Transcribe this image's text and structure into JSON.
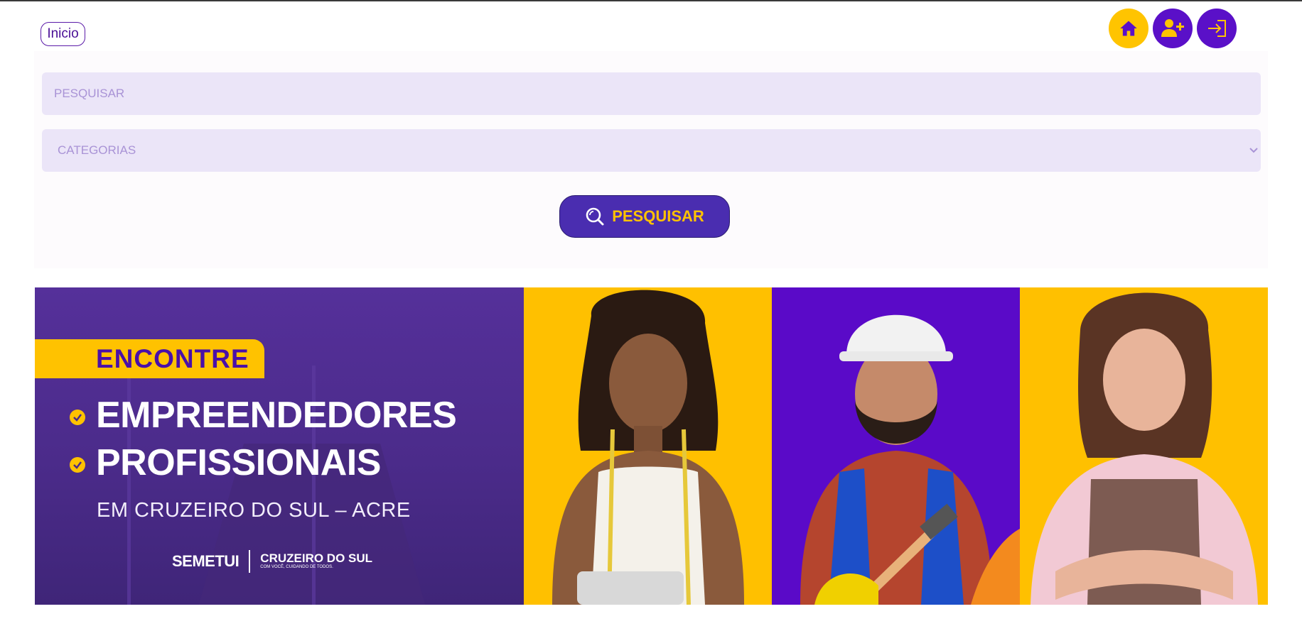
{
  "nav": {
    "inicio_label": "Inicio"
  },
  "header_icons": [
    {
      "icon": "home-icon",
      "color": "#ffc400"
    },
    {
      "icon": "user-plus-icon",
      "color": "#5a10c8"
    },
    {
      "icon": "login-icon",
      "color": "#5a10c8"
    }
  ],
  "search": {
    "placeholder": "PESQUISAR",
    "categories_placeholder": "CATEGORIAS",
    "button_label": "PESQUISAR"
  },
  "banner": {
    "tag": "ENCONTRE",
    "items": [
      "EMPREENDEDORES",
      "PROFISSIONAIS"
    ],
    "subtitle": "EM CRUZEIRO DO SUL – ACRE",
    "logo_semetui": "SEMETUI",
    "logo_cruzeiro": "CRUZEIRO DO SUL",
    "logo_cruzeiro_sub": "COM VOCÊ, CUIDANDO DE TODOS."
  },
  "colors": {
    "brand_purple": "#4a2db0",
    "brand_yellow": "#ffc200",
    "field_bg": "#ebe5f8"
  }
}
